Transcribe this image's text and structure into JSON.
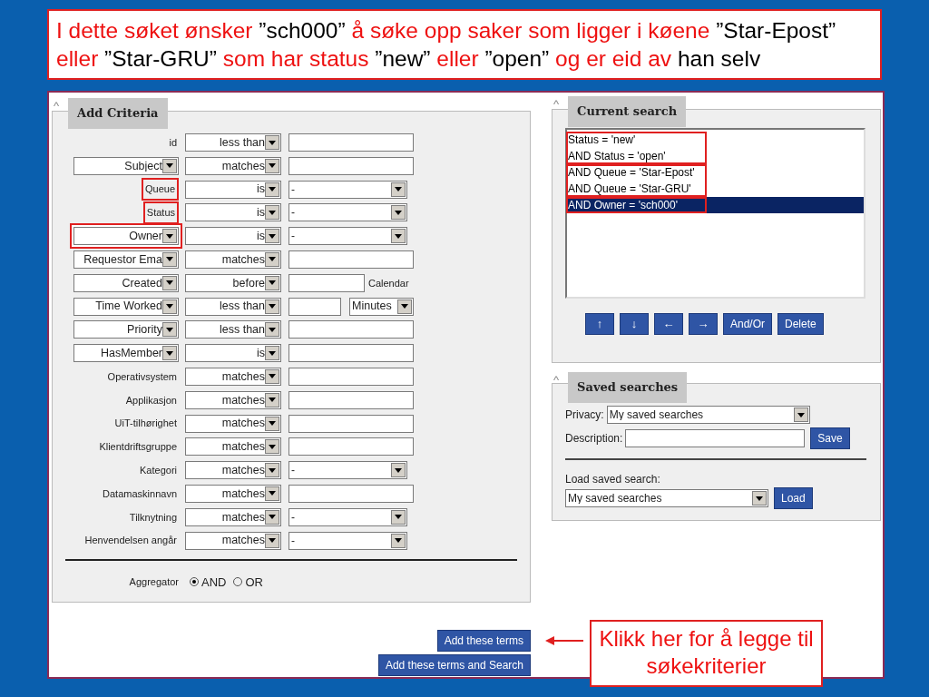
{
  "caption": {
    "segments": [
      {
        "text": "I dette søket ønsker ",
        "kind": "accent"
      },
      {
        "text": "”sch000” ",
        "kind": "plain"
      },
      {
        "text": "å søke opp saker som ligger i køene ",
        "kind": "accent"
      },
      {
        "text": "”Star-Epost” ",
        "kind": "plain"
      },
      {
        "text": "eller ",
        "kind": "accent"
      },
      {
        "text": "”Star-GRU” ",
        "kind": "plain"
      },
      {
        "text": "som har status ",
        "kind": "accent"
      },
      {
        "text": "”new” ",
        "kind": "plain"
      },
      {
        "text": "eller ",
        "kind": "accent"
      },
      {
        "text": "”open” ",
        "kind": "plain"
      },
      {
        "text": "og er eid av ",
        "kind": "accent"
      },
      {
        "text": "han selv",
        "kind": "plain"
      }
    ]
  },
  "add_criteria": {
    "title": "Add Criteria",
    "collapse_icon": "^",
    "rows": [
      {
        "field": {
          "kind": "label",
          "text": "id",
          "highlighted": false
        },
        "operator": "less than",
        "value": {
          "kind": "text"
        }
      },
      {
        "field": {
          "kind": "select",
          "text": "Subject",
          "highlighted": false
        },
        "operator": "matches",
        "value": {
          "kind": "text"
        }
      },
      {
        "field": {
          "kind": "label",
          "text": "Queue",
          "highlighted": true
        },
        "operator": "is",
        "value": {
          "kind": "select",
          "text": "-"
        }
      },
      {
        "field": {
          "kind": "label",
          "text": "Status",
          "highlighted": true
        },
        "operator": "is",
        "value": {
          "kind": "select",
          "text": "-"
        }
      },
      {
        "field": {
          "kind": "select",
          "text": "Owner",
          "highlighted": true
        },
        "operator": "is",
        "value": {
          "kind": "select",
          "text": "-"
        }
      },
      {
        "field": {
          "kind": "select",
          "text": "Requestor Ema",
          "highlighted": false
        },
        "operator": "matches",
        "value": {
          "kind": "text"
        }
      },
      {
        "field": {
          "kind": "select",
          "text": "Created",
          "highlighted": false
        },
        "operator": "before",
        "value": {
          "kind": "date",
          "text": "Calendar"
        }
      },
      {
        "field": {
          "kind": "select",
          "text": "Time Worked",
          "highlighted": false
        },
        "operator": "less than",
        "value": {
          "kind": "number",
          "text": "Minutes"
        }
      },
      {
        "field": {
          "kind": "select",
          "text": "Priority",
          "highlighted": false
        },
        "operator": "less than",
        "value": {
          "kind": "text"
        }
      },
      {
        "field": {
          "kind": "select",
          "text": "HasMember",
          "highlighted": false
        },
        "operator": "is",
        "value": {
          "kind": "text"
        }
      },
      {
        "field": {
          "kind": "label",
          "text": "Operativsystem",
          "highlighted": false
        },
        "operator": "matches",
        "value": {
          "kind": "text"
        }
      },
      {
        "field": {
          "kind": "label",
          "text": "Applikasjon",
          "highlighted": false
        },
        "operator": "matches",
        "value": {
          "kind": "text"
        }
      },
      {
        "field": {
          "kind": "label",
          "text": "UiT-tilhørighet",
          "highlighted": false
        },
        "operator": "matches",
        "value": {
          "kind": "text"
        }
      },
      {
        "field": {
          "kind": "label",
          "text": "Klientdriftsgruppe",
          "highlighted": false
        },
        "operator": "matches",
        "value": {
          "kind": "text"
        }
      },
      {
        "field": {
          "kind": "label",
          "text": "Kategori",
          "highlighted": false
        },
        "operator": "matches",
        "value": {
          "kind": "select",
          "text": "-"
        }
      },
      {
        "field": {
          "kind": "label",
          "text": "Datamaskinnavn",
          "highlighted": false
        },
        "operator": "matches",
        "value": {
          "kind": "text"
        }
      },
      {
        "field": {
          "kind": "label",
          "text": "Tilknytning",
          "highlighted": false
        },
        "operator": "matches",
        "value": {
          "kind": "select",
          "text": "-"
        }
      },
      {
        "field": {
          "kind": "label",
          "text": "Henvendelsen angår",
          "highlighted": false
        },
        "operator": "matches",
        "value": {
          "kind": "select",
          "text": "-"
        }
      }
    ],
    "aggregator": {
      "label": "Aggregator",
      "options": [
        {
          "label": "AND",
          "selected": true
        },
        {
          "label": "OR",
          "selected": false
        }
      ]
    }
  },
  "actions": [
    "Add these terms",
    "Add these terms and Search"
  ],
  "current_search": {
    "title": "Current search",
    "collapse_icon": "^",
    "groups": [
      {
        "annotated": true,
        "lines": [
          {
            "text": "Status = 'new'",
            "selected": false
          },
          {
            "text": "AND Status = 'open'",
            "selected": false
          }
        ]
      },
      {
        "annotated": true,
        "lines": [
          {
            "text": "AND Queue = 'Star-Epost'",
            "selected": false
          },
          {
            "text": "AND Queue = 'Star-GRU'",
            "selected": false
          }
        ]
      },
      {
        "annotated": true,
        "lines": [
          {
            "text": "AND Owner = 'sch000'",
            "selected": true
          }
        ]
      }
    ],
    "buttons": [
      "↑",
      "↓",
      "←",
      "→",
      "And/Or",
      "Delete"
    ]
  },
  "saved_searches": {
    "title": "Saved searches",
    "collapse_icon": "^",
    "privacy_label": "Privacy:",
    "privacy_value": "My saved searches",
    "description_label": "Description:",
    "save_button": "Save",
    "load_label": "Load saved search:",
    "load_value": "My saved searches",
    "load_button": "Load"
  },
  "callout": {
    "text": "Klikk her for å legge til søkekriterier"
  }
}
